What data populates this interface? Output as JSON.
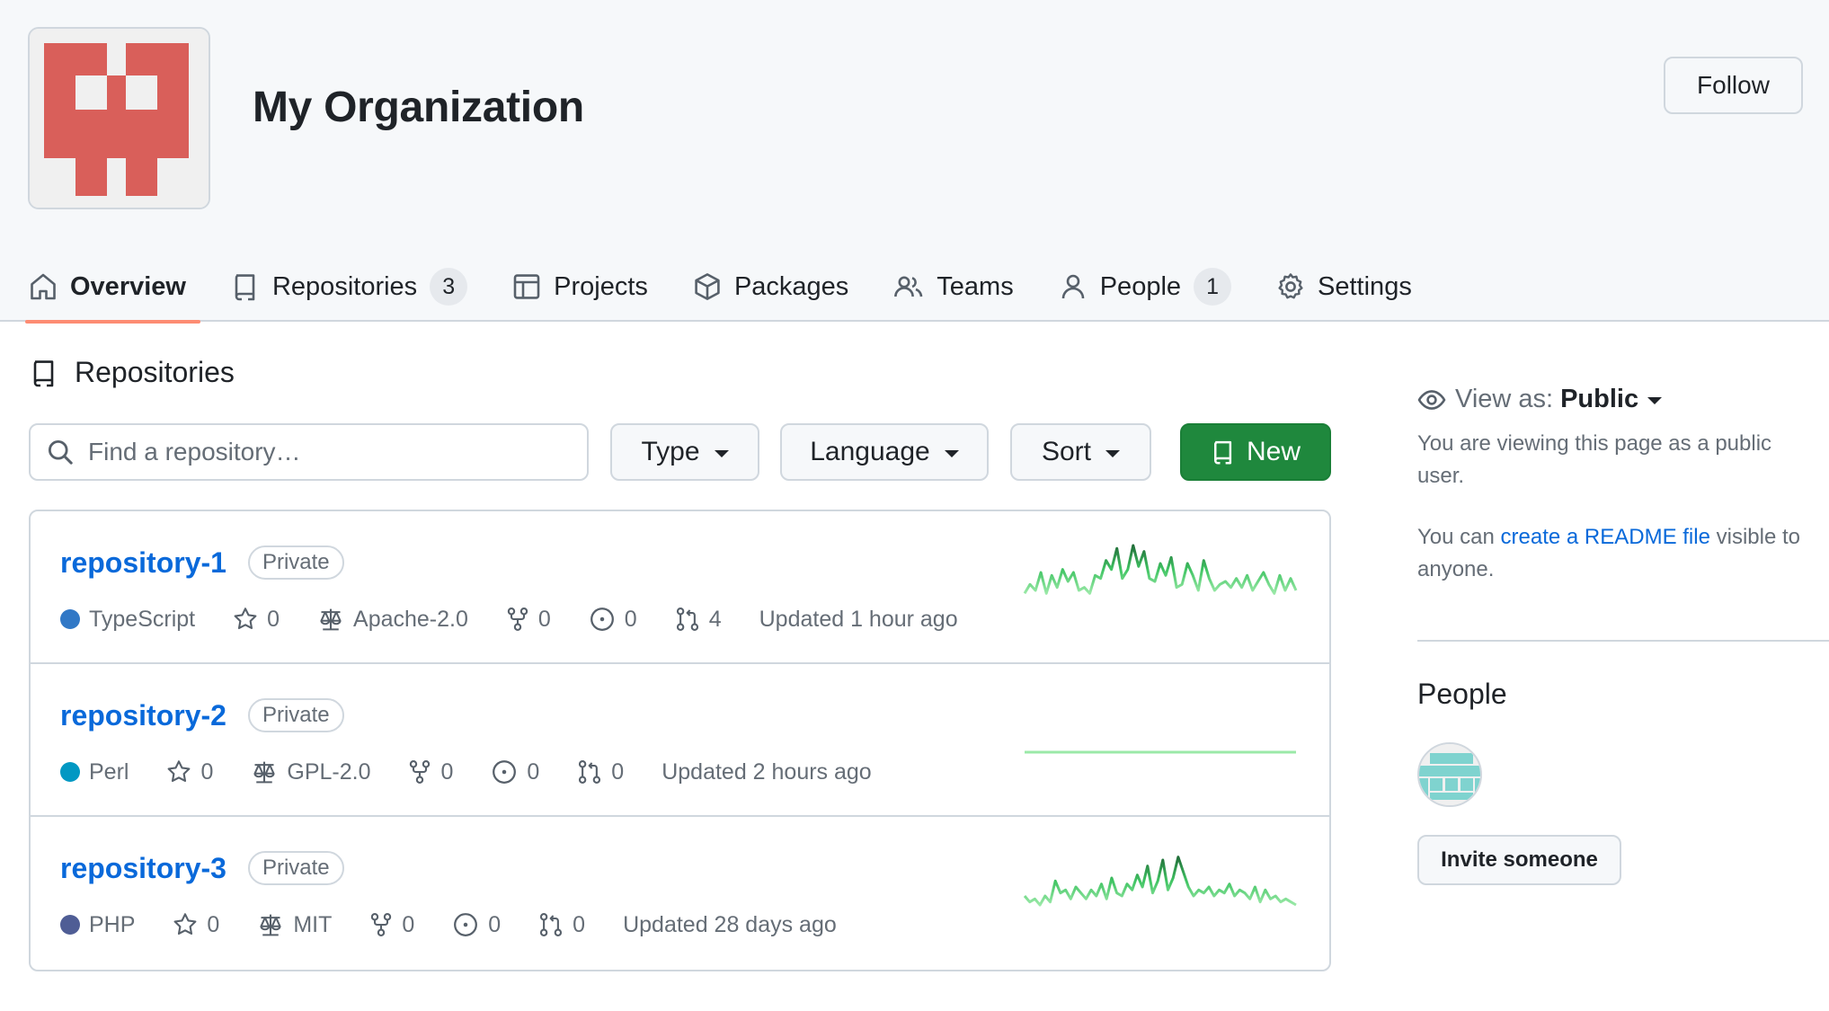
{
  "org": {
    "name": "My Organization",
    "follow_label": "Follow"
  },
  "nav": {
    "overview": "Overview",
    "repositories": "Repositories",
    "repositories_count": "3",
    "projects": "Projects",
    "packages": "Packages",
    "teams": "Teams",
    "people": "People",
    "people_count": "1",
    "settings": "Settings"
  },
  "main": {
    "section_title": "Repositories",
    "search_placeholder": "Find a repository…",
    "filters": {
      "type": "Type",
      "language": "Language",
      "sort": "Sort"
    },
    "new_label": "New"
  },
  "repos": [
    {
      "name": "repository-1",
      "visibility": "Private",
      "language": "TypeScript",
      "language_color": "#3178c6",
      "stars": "0",
      "license": "Apache-2.0",
      "forks": "0",
      "issues": "0",
      "pulls": "4",
      "updated": "Updated 1 hour ago",
      "activity": [
        2,
        5,
        3,
        9,
        2,
        8,
        4,
        10,
        6,
        9,
        3,
        4,
        2,
        8,
        7,
        13,
        10,
        17,
        7,
        10,
        18,
        11,
        16,
        7,
        6,
        12,
        8,
        14,
        4,
        5,
        12,
        8,
        3,
        13,
        7,
        3,
        5,
        6,
        4,
        7,
        4,
        8,
        3,
        6,
        9,
        5,
        2,
        8,
        3,
        7,
        3
      ]
    },
    {
      "name": "repository-2",
      "visibility": "Private",
      "language": "Perl",
      "language_color": "#0298c3",
      "stars": "0",
      "license": "GPL-2.0",
      "forks": "0",
      "issues": "0",
      "pulls": "0",
      "updated": "Updated 2 hours ago",
      "activity": [
        0,
        0,
        0,
        0,
        0,
        0,
        0,
        0,
        0,
        0,
        0,
        0,
        0,
        0,
        0,
        0,
        0,
        0,
        0,
        0,
        0,
        0,
        0,
        0,
        0,
        0,
        0,
        0,
        0,
        0,
        0,
        0,
        0,
        0,
        0,
        0,
        0,
        0,
        0,
        0,
        0,
        0,
        0,
        0,
        0,
        0,
        0,
        0,
        0,
        0,
        0
      ]
    },
    {
      "name": "repository-3",
      "visibility": "Private",
      "language": "PHP",
      "language_color": "#4f5d95",
      "stars": "0",
      "license": "MIT",
      "forks": "0",
      "issues": "0",
      "pulls": "0",
      "updated": "Updated 28 days ago",
      "activity": [
        3,
        1,
        2,
        0,
        3,
        1,
        8,
        4,
        5,
        2,
        6,
        4,
        2,
        5,
        3,
        7,
        2,
        9,
        4,
        3,
        7,
        5,
        10,
        6,
        13,
        4,
        8,
        15,
        5,
        9,
        16,
        11,
        6,
        3,
        5,
        4,
        6,
        3,
        5,
        4,
        7,
        3,
        5,
        4,
        2,
        6,
        1,
        5,
        2,
        3,
        1,
        2,
        1,
        0
      ]
    }
  ],
  "sidebar": {
    "view_as_label": "View as:",
    "view_as_value": "Public",
    "viewing_note": "You are viewing this page as a public user.",
    "readme_prefix": "You can ",
    "readme_link": "create a README file",
    "readme_suffix": " visible to anyone.",
    "people_title": "People",
    "invite_label": "Invite someone"
  },
  "colors": {
    "accent": "#fd8c73",
    "primary": "#1f883d",
    "link": "#0969da",
    "spark": "#216e39"
  }
}
